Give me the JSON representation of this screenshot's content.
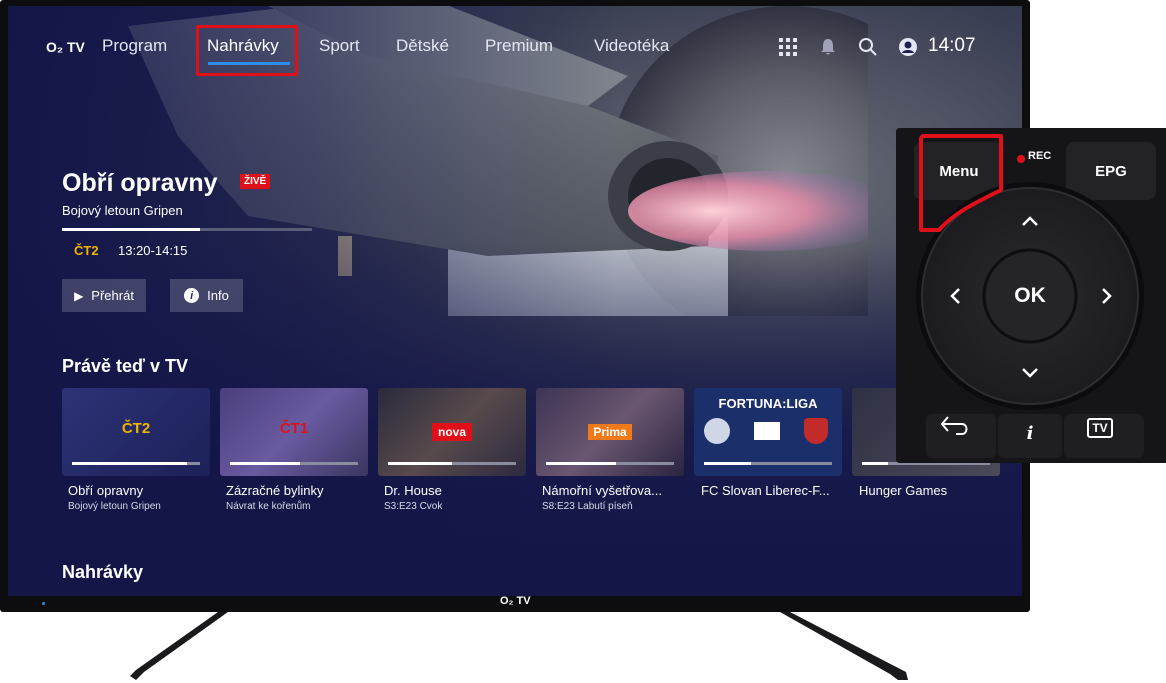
{
  "nav": {
    "logo": "O₂ TV",
    "items": [
      "Program",
      "Nahrávky",
      "Sport",
      "Dětské",
      "Premium",
      "Videotéka"
    ],
    "active": "Nahrávky",
    "time": "14:07"
  },
  "hero": {
    "title": "Obří opravny",
    "badge": "ŽIVĚ",
    "subtitle": "Bojový letoun Gripen",
    "channel": "ČT2",
    "time_range": "13:20-14:15",
    "progress": 0.55,
    "play_label": "Přehrát",
    "info_label": "Info"
  },
  "sections": {
    "now_on_tv": "Právě teď v TV",
    "recordings": "Nahrávky"
  },
  "cards": [
    {
      "title": "Obří opravny",
      "sub": "Bojový letoun Gripen",
      "logo": "ČT2",
      "progress": 0.9
    },
    {
      "title": "Zázračné bylinky",
      "sub": "Návrat ke kořenům",
      "logo": "ČT1",
      "progress": 0.55
    },
    {
      "title": "Dr. House",
      "sub": "S3:E23 Cvok",
      "logo": "nova",
      "progress": 0.5
    },
    {
      "title": "Námořní vyšetřova...",
      "sub": "S8:E23 Labutí píseň",
      "logo": "Prima",
      "progress": 0.55
    },
    {
      "title": "FC Slovan Liberec-F...",
      "sub": "",
      "logo": "FORTUNA:LIGA",
      "progress": 0.37
    },
    {
      "title": "Hunger Games",
      "sub": "",
      "logo": "",
      "progress": 0.2
    }
  ],
  "tv_brand": "O₂ TV",
  "remote": {
    "menu": "Menu",
    "rec": "REC",
    "epg": "EPG",
    "ok": "OK",
    "tv": "TV",
    "info": "i"
  },
  "colors": {
    "highlight_red": "#e0101a",
    "accent_blue": "#2e8de8",
    "live_red": "#e0101a",
    "ct_yellow": "#f0b400"
  }
}
